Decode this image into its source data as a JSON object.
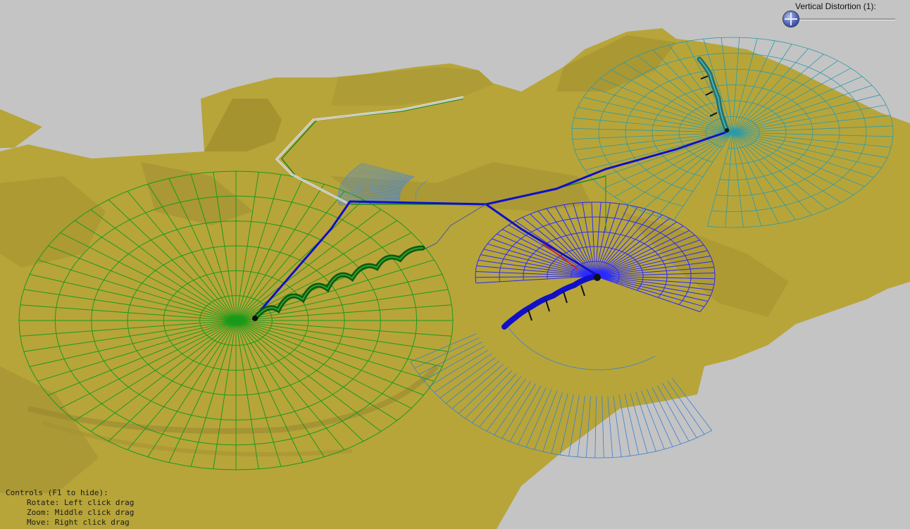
{
  "viewer": {
    "distortion_label": "Vertical Distortion (1):",
    "distortion_value": 1
  },
  "controls": {
    "title": "Controls (F1 to hide):",
    "rotate": "Rotate: Left click drag",
    "zoom": "Zoom: Middle click drag",
    "move": "Move: Right click drag"
  },
  "colors": {
    "background": "#c4c4c4",
    "terrain": "#b7a53a",
    "terrain_shadow": "#8a7a22",
    "grid_green": "#1a9a1a",
    "grid_blue": "#2a2aff",
    "grid_teal": "#2a9aaa",
    "pipe_blue": "#1010c8",
    "pipe_white": "#e6e6e6",
    "pipe_red": "#cc2222"
  }
}
